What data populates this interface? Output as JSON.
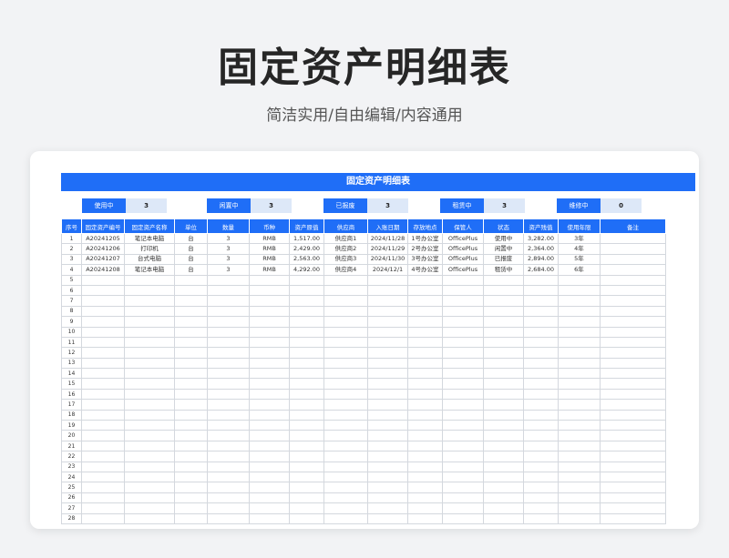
{
  "header": {
    "title": "固定资产明细表",
    "subtitle": "简洁实用/自由编辑/内容通用"
  },
  "sheet": {
    "title": "固定资产明细表",
    "status_summary": [
      {
        "label": "使用中",
        "value": "3"
      },
      {
        "label": "闲置中",
        "value": "3"
      },
      {
        "label": "已报废",
        "value": "3"
      },
      {
        "label": "租赁中",
        "value": "3"
      },
      {
        "label": "维修中",
        "value": "0"
      }
    ],
    "columns": [
      "序号",
      "固定资产编号",
      "固定资产名称",
      "单位",
      "数量",
      "币种",
      "资产原值",
      "供应商",
      "入账日期",
      "存放地点",
      "保管人",
      "状态",
      "资产残值",
      "使用年限",
      "备注"
    ],
    "rows": [
      [
        "1",
        "A20241205",
        "笔记本电脑",
        "台",
        "3",
        "RMB",
        "1,517.00",
        "供应商1",
        "2024/11/28",
        "1号办公室",
        "OfficePlus",
        "使用中",
        "3,282.00",
        "3年",
        ""
      ],
      [
        "2",
        "A20241206",
        "打印机",
        "台",
        "3",
        "RMB",
        "2,429.00",
        "供应商2",
        "2024/11/29",
        "2号办公室",
        "OfficePlus",
        "闲置中",
        "2,364.00",
        "4年",
        ""
      ],
      [
        "3",
        "A20241207",
        "台式电脑",
        "台",
        "3",
        "RMB",
        "2,563.00",
        "供应商3",
        "2024/11/30",
        "3号办公室",
        "OfficePlus",
        "已报废",
        "2,894.00",
        "5年",
        ""
      ],
      [
        "4",
        "A20241208",
        "笔记本电脑",
        "台",
        "3",
        "RMB",
        "4,292.00",
        "供应商4",
        "2024/12/1",
        "4号办公室",
        "OfficePlus",
        "租赁中",
        "2,684.00",
        "6年",
        ""
      ]
    ],
    "empty_row_numbers": [
      "5",
      "6",
      "7",
      "8",
      "9",
      "10",
      "11",
      "12",
      "13",
      "14",
      "15",
      "16",
      "17",
      "18",
      "19",
      "20",
      "21",
      "22",
      "23",
      "24",
      "25",
      "26",
      "27",
      "28"
    ],
    "colors": {
      "accent": "#1f6ef7",
      "summary_value_bg": "#dde8f8",
      "grid_line": "#d4d8de"
    }
  }
}
